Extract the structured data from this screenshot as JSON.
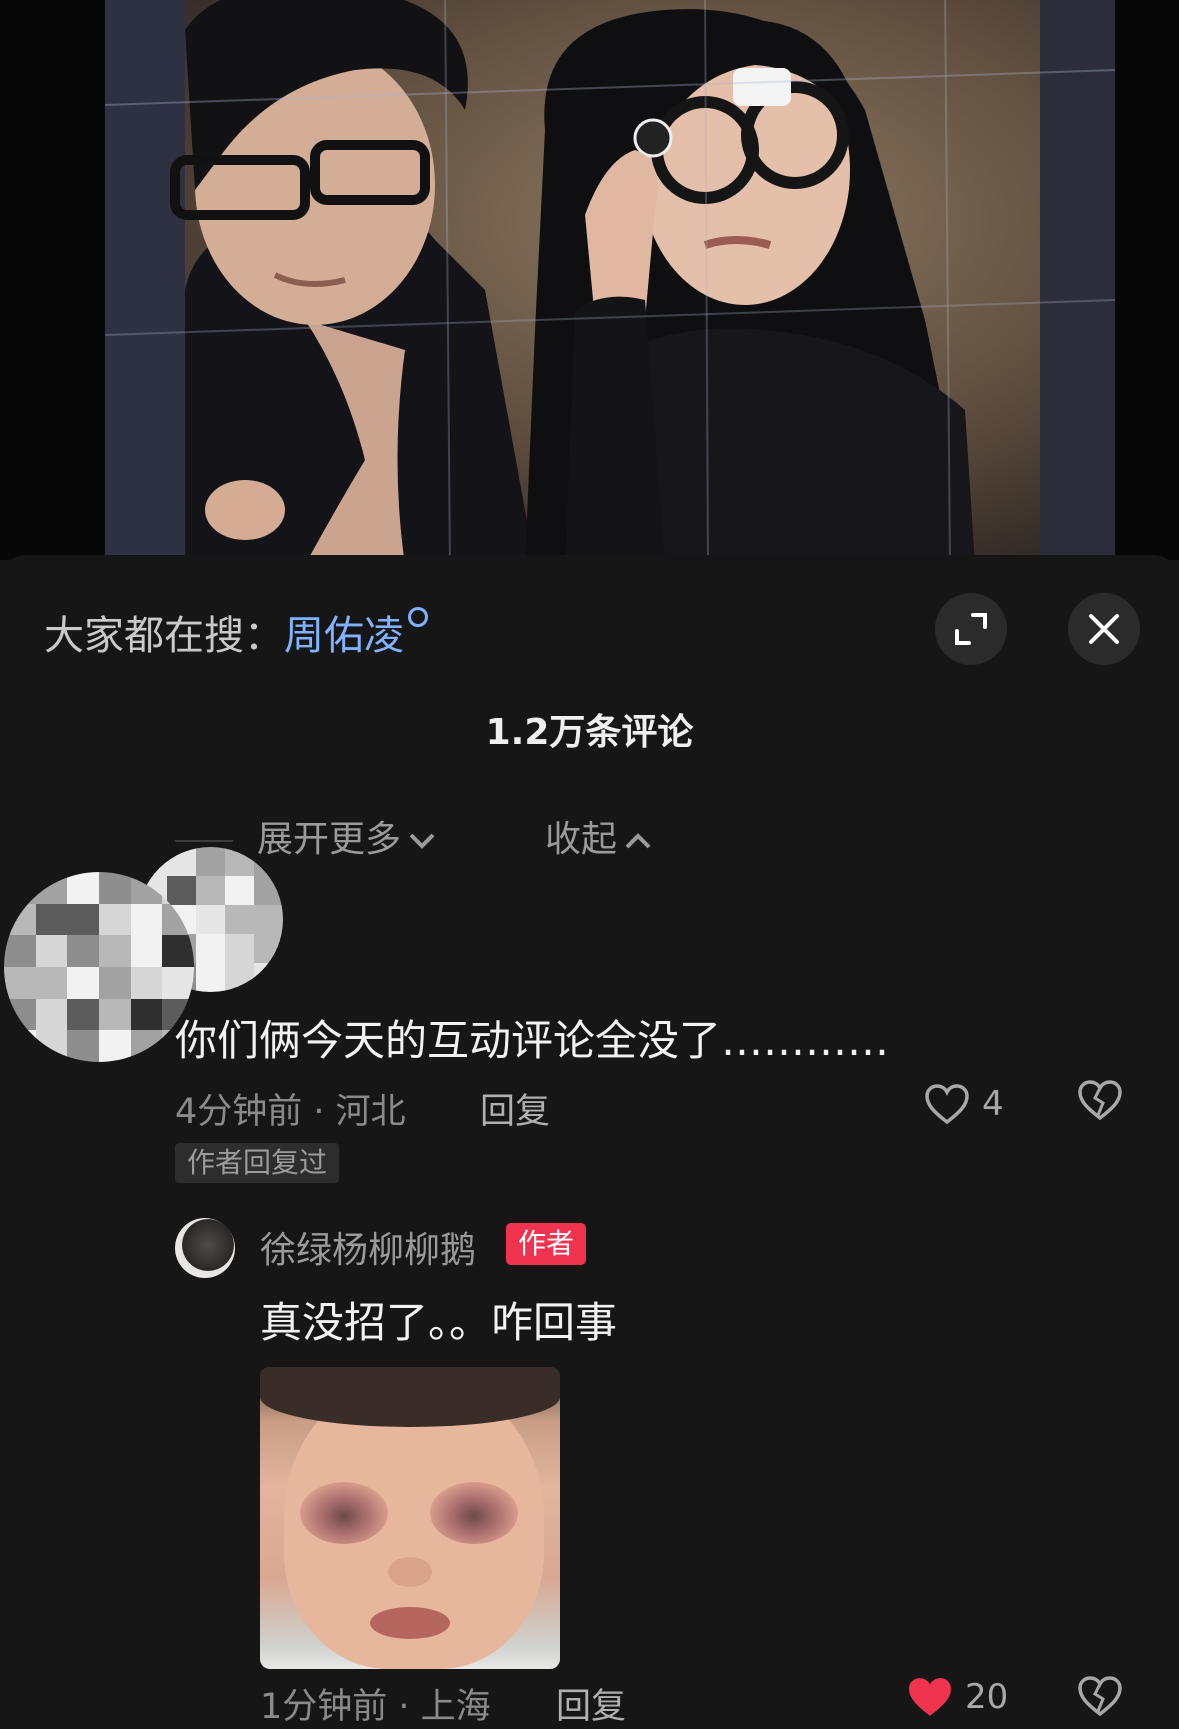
{
  "search": {
    "prefix": "大家都在搜：",
    "keyword": "周佑凌"
  },
  "comments_header": {
    "count_label": "1.2万条评论"
  },
  "thread_controls": {
    "expand_label": "展开更多",
    "collapse_label": "收起"
  },
  "comment": {
    "text": "你们俩今天的互动评论全没了…………",
    "time_location": "4分钟前 · 河北",
    "reply_label": "回复",
    "likes": "4",
    "author_replied_badge": "作者回复过"
  },
  "reply": {
    "username": "徐绿杨柳柳鹅",
    "author_badge": "作者",
    "text": "真没招了。。咋回事",
    "time_location": "1分钟前 · 上海",
    "reply_label": "回复",
    "likes": "20",
    "liked": true
  },
  "colors": {
    "background": "#161616",
    "keyword": "#7fb2ff",
    "author_badge": "#f0334f",
    "liked_heart": "#f0334f"
  },
  "icons": {
    "search": "search-icon",
    "expand": "expand-icon",
    "close": "close-icon",
    "like": "heart-icon",
    "dislike": "broken-heart-icon",
    "chevron_down": "chevron-down-icon",
    "chevron_up": "chevron-up-icon"
  }
}
